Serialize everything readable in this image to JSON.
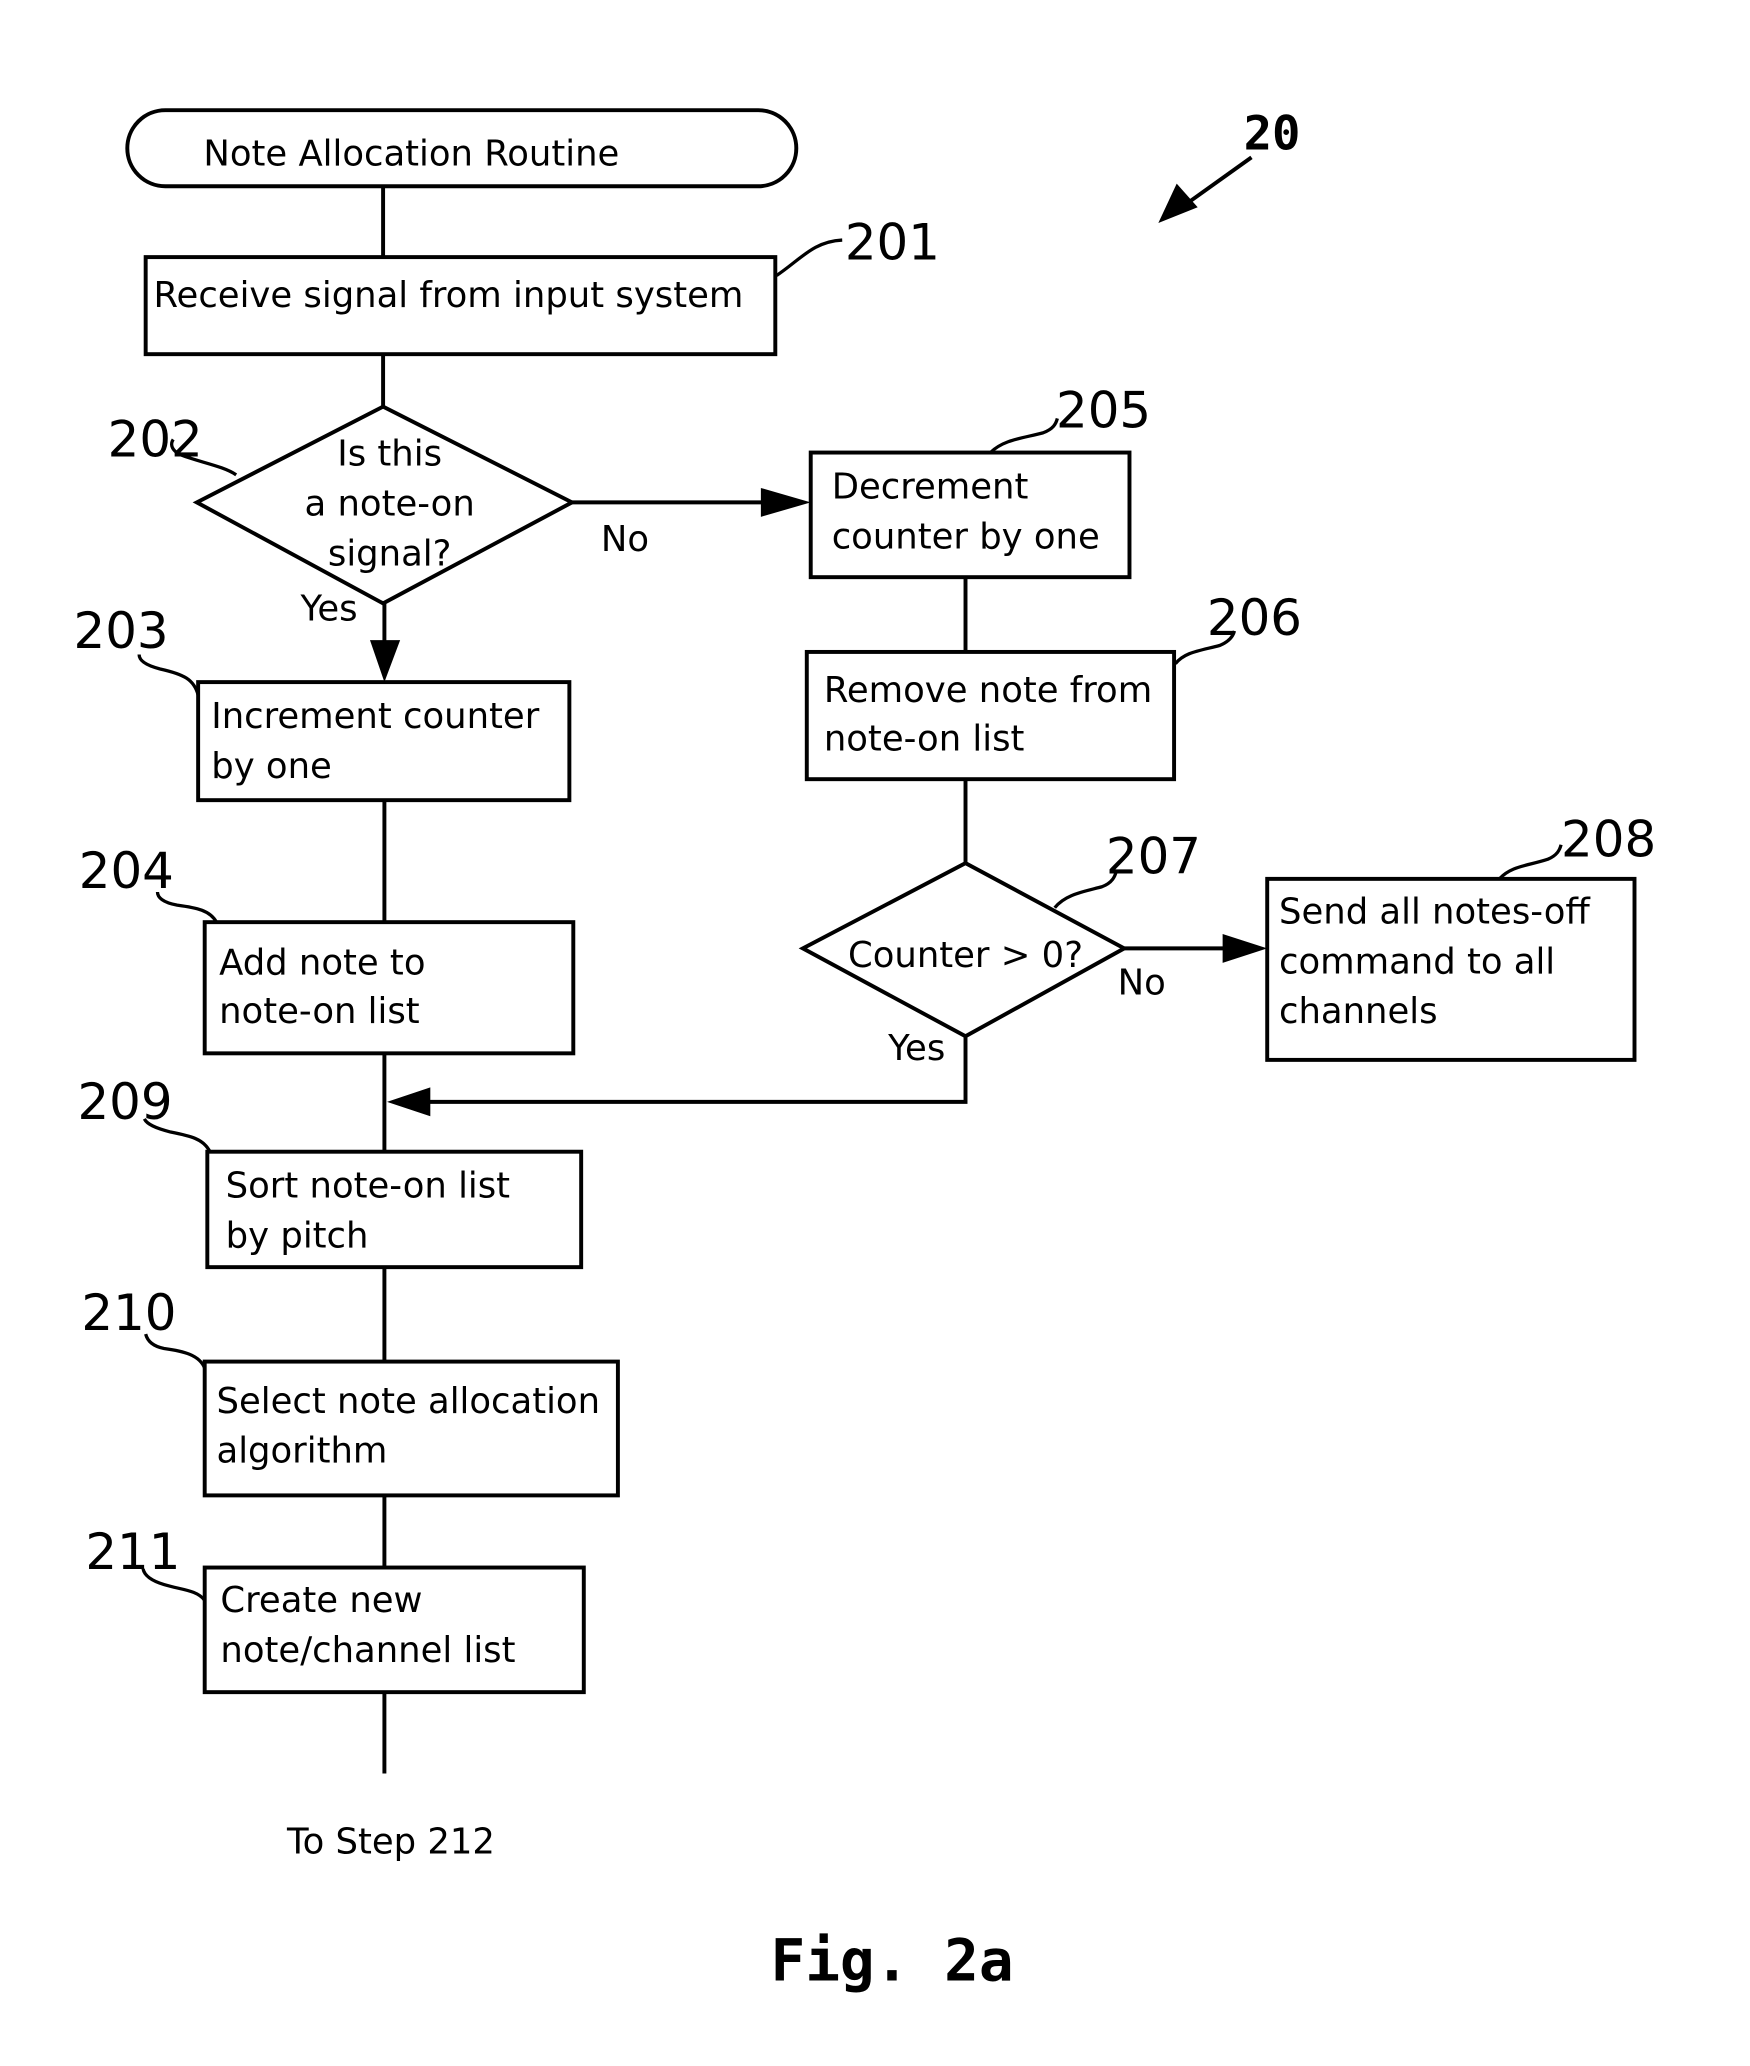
{
  "figure": {
    "label": "Fig. 2a",
    "reference_numeral": "20"
  },
  "start": {
    "label": "Note Allocation Routine"
  },
  "steps": {
    "s201": {
      "ref": "201",
      "lines": [
        "Receive signal from input system"
      ]
    },
    "s202": {
      "ref": "202",
      "lines": [
        "Is this",
        "a note-on",
        "signal?"
      ],
      "yes": "Yes",
      "no": "No"
    },
    "s203": {
      "ref": "203",
      "lines": [
        "Increment counter",
        "by one"
      ]
    },
    "s204": {
      "ref": "204",
      "lines": [
        "Add note to",
        "note-on list"
      ]
    },
    "s205": {
      "ref": "205",
      "lines": [
        "Decrement",
        "counter by one"
      ]
    },
    "s206": {
      "ref": "206",
      "lines": [
        "Remove note from",
        "note-on list"
      ]
    },
    "s207": {
      "ref": "207",
      "lines": [
        "Counter > 0?"
      ],
      "yes": "Yes",
      "no": "No"
    },
    "s208": {
      "ref": "208",
      "lines": [
        "Send all notes-off",
        "command to all",
        "channels"
      ]
    },
    "s209": {
      "ref": "209",
      "lines": [
        "Sort note-on list",
        "by pitch"
      ]
    },
    "s210": {
      "ref": "210",
      "lines": [
        "Select note allocation",
        "algorithm"
      ]
    },
    "s211": {
      "ref": "211",
      "lines": [
        "Create new",
        "note/channel list"
      ]
    }
  },
  "continuation": {
    "label": "To Step 212"
  }
}
